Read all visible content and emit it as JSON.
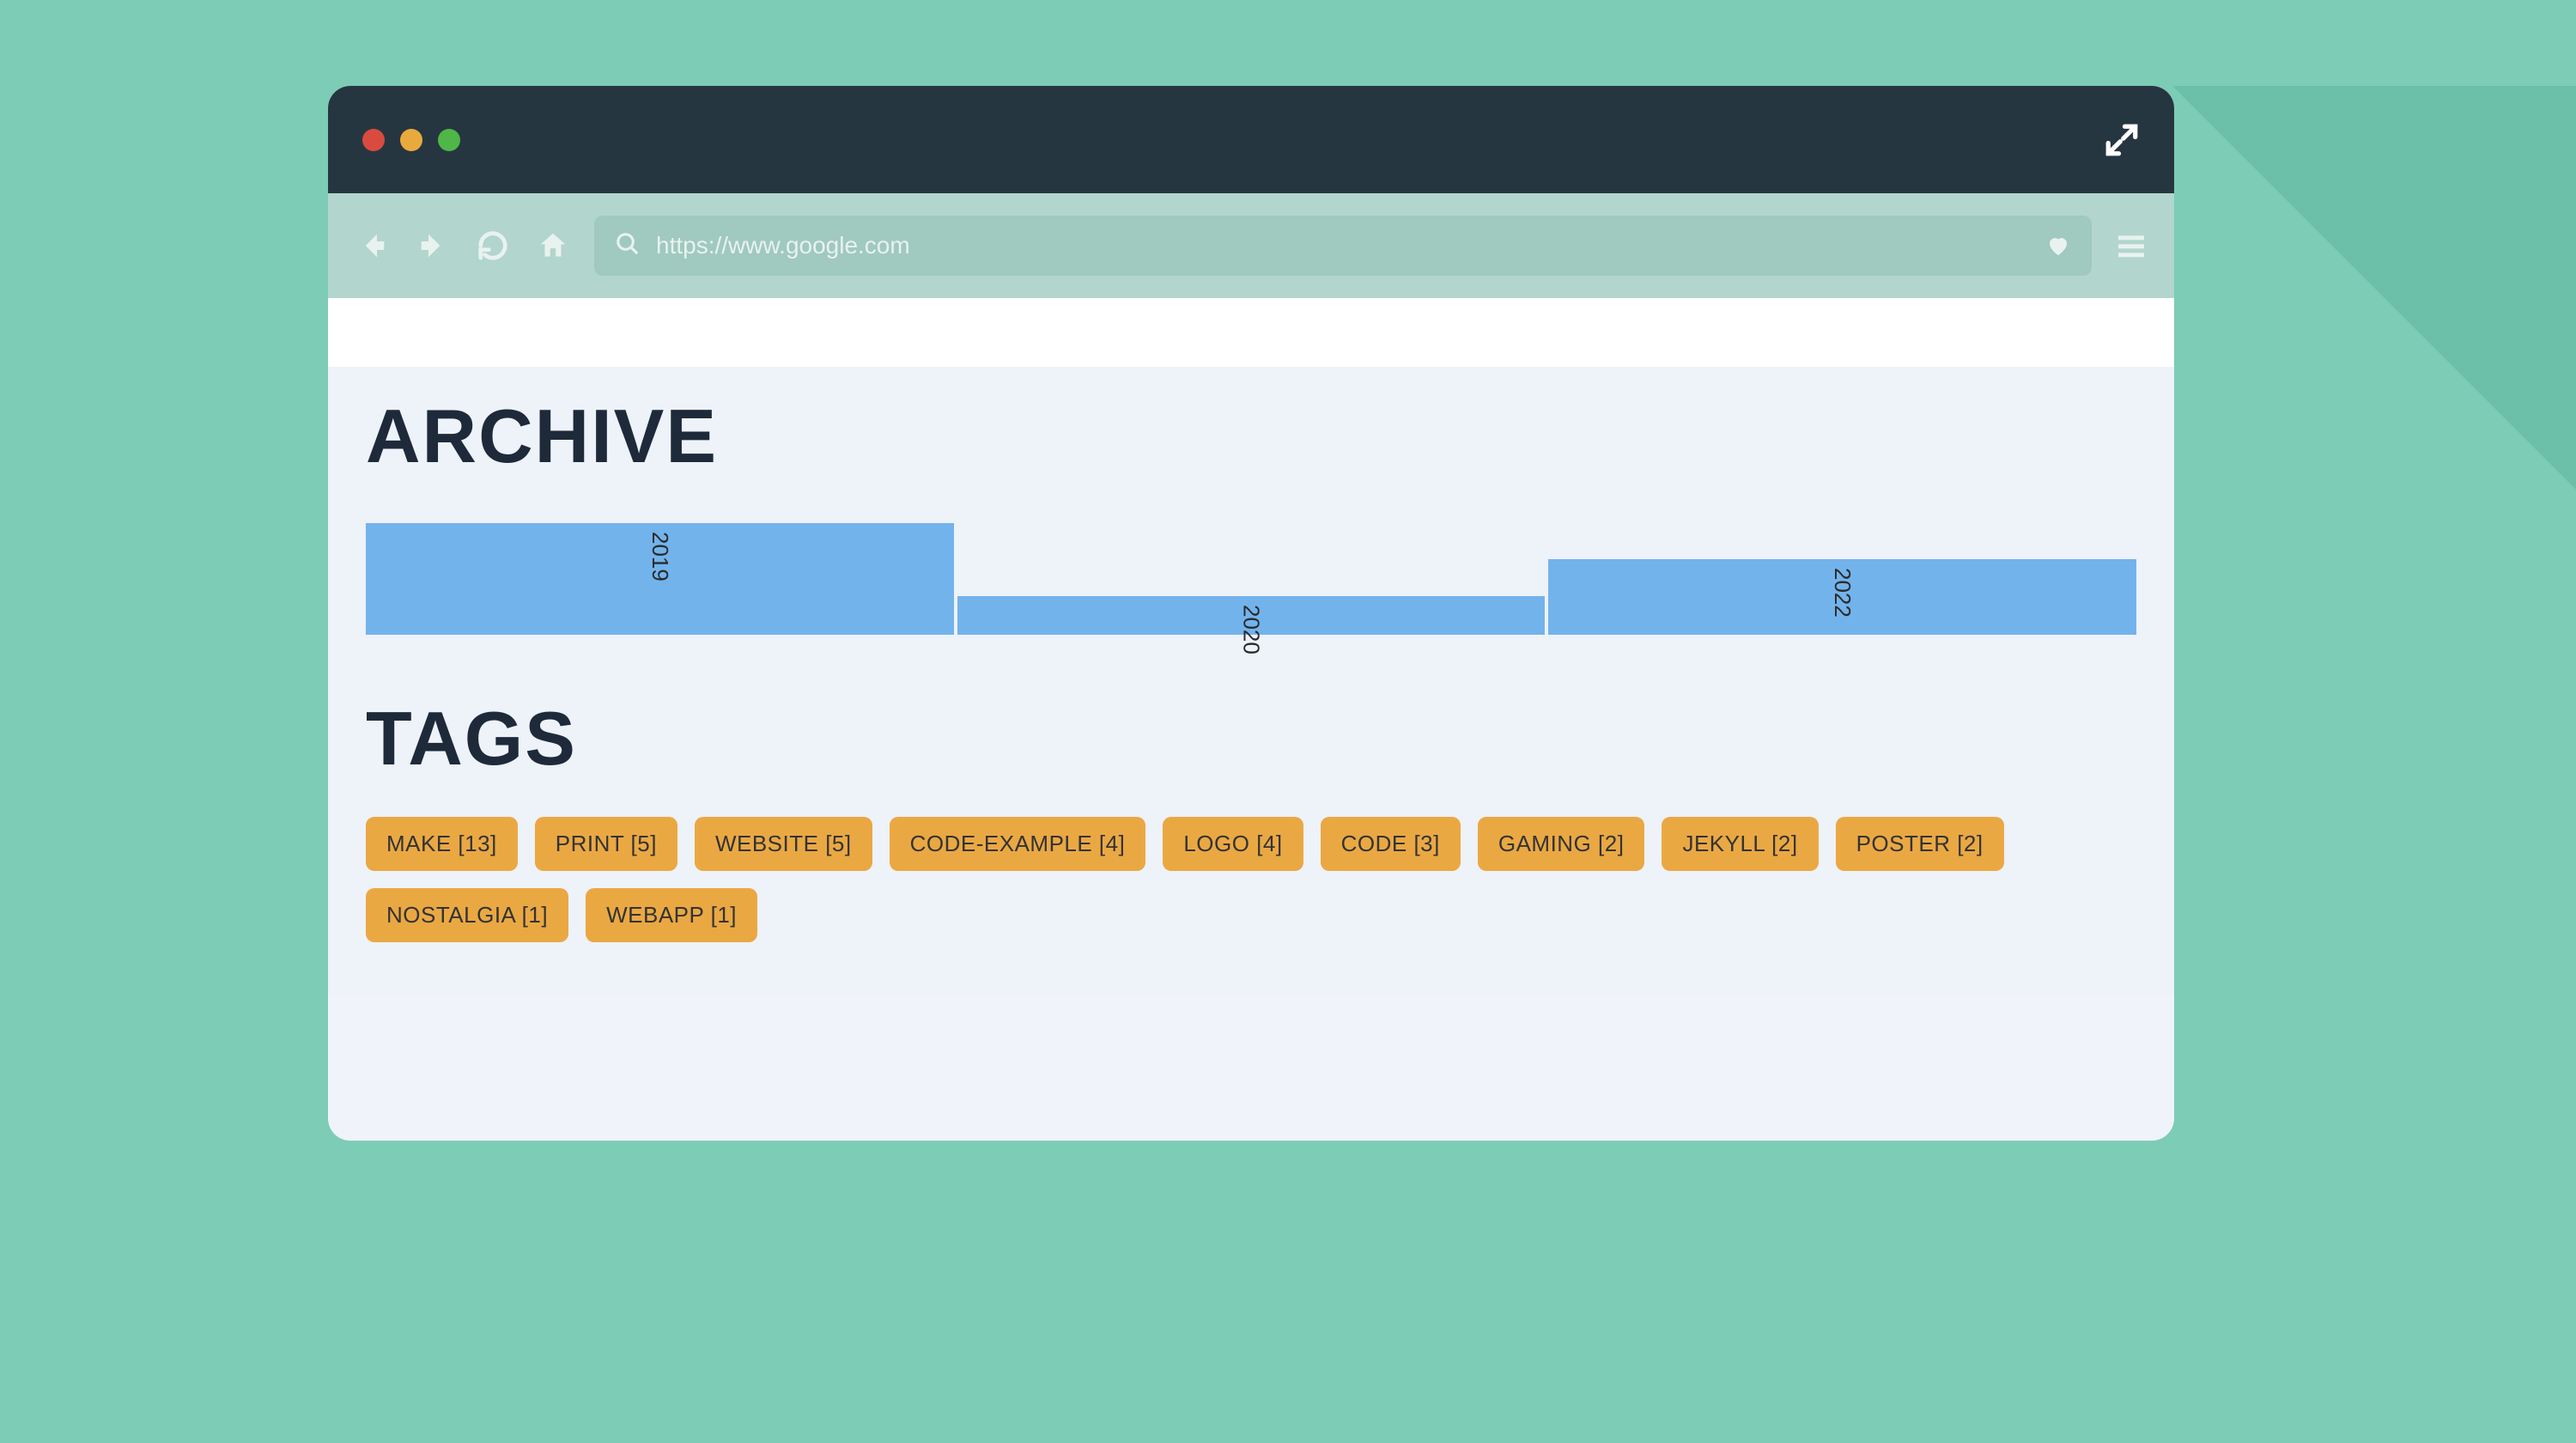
{
  "browser": {
    "url": "https://www.google.com",
    "placeholder": "https://www.google.com"
  },
  "page": {
    "archive_heading": "ARCHIVE",
    "tags_heading": "TAGS"
  },
  "chart_data": {
    "type": "bar",
    "title": "ARCHIVE",
    "categories": [
      "2019",
      "2020",
      "2022"
    ],
    "values": [
      130,
      45,
      88
    ],
    "ylim": [
      0,
      140
    ],
    "note": "bar heights are relative post-frequency estimates; exact counts not labeled"
  },
  "tags": [
    {
      "label": "MAKE [13]"
    },
    {
      "label": "PRINT [5]"
    },
    {
      "label": "WEBSITE [5]"
    },
    {
      "label": "CODE-EXAMPLE [4]"
    },
    {
      "label": "LOGO [4]"
    },
    {
      "label": "CODE [3]"
    },
    {
      "label": "GAMING [2]"
    },
    {
      "label": "JEKYLL [2]"
    },
    {
      "label": "POSTER [2]"
    },
    {
      "label": "NOSTALGIA [1]"
    },
    {
      "label": "WEBAPP [1]"
    }
  ]
}
